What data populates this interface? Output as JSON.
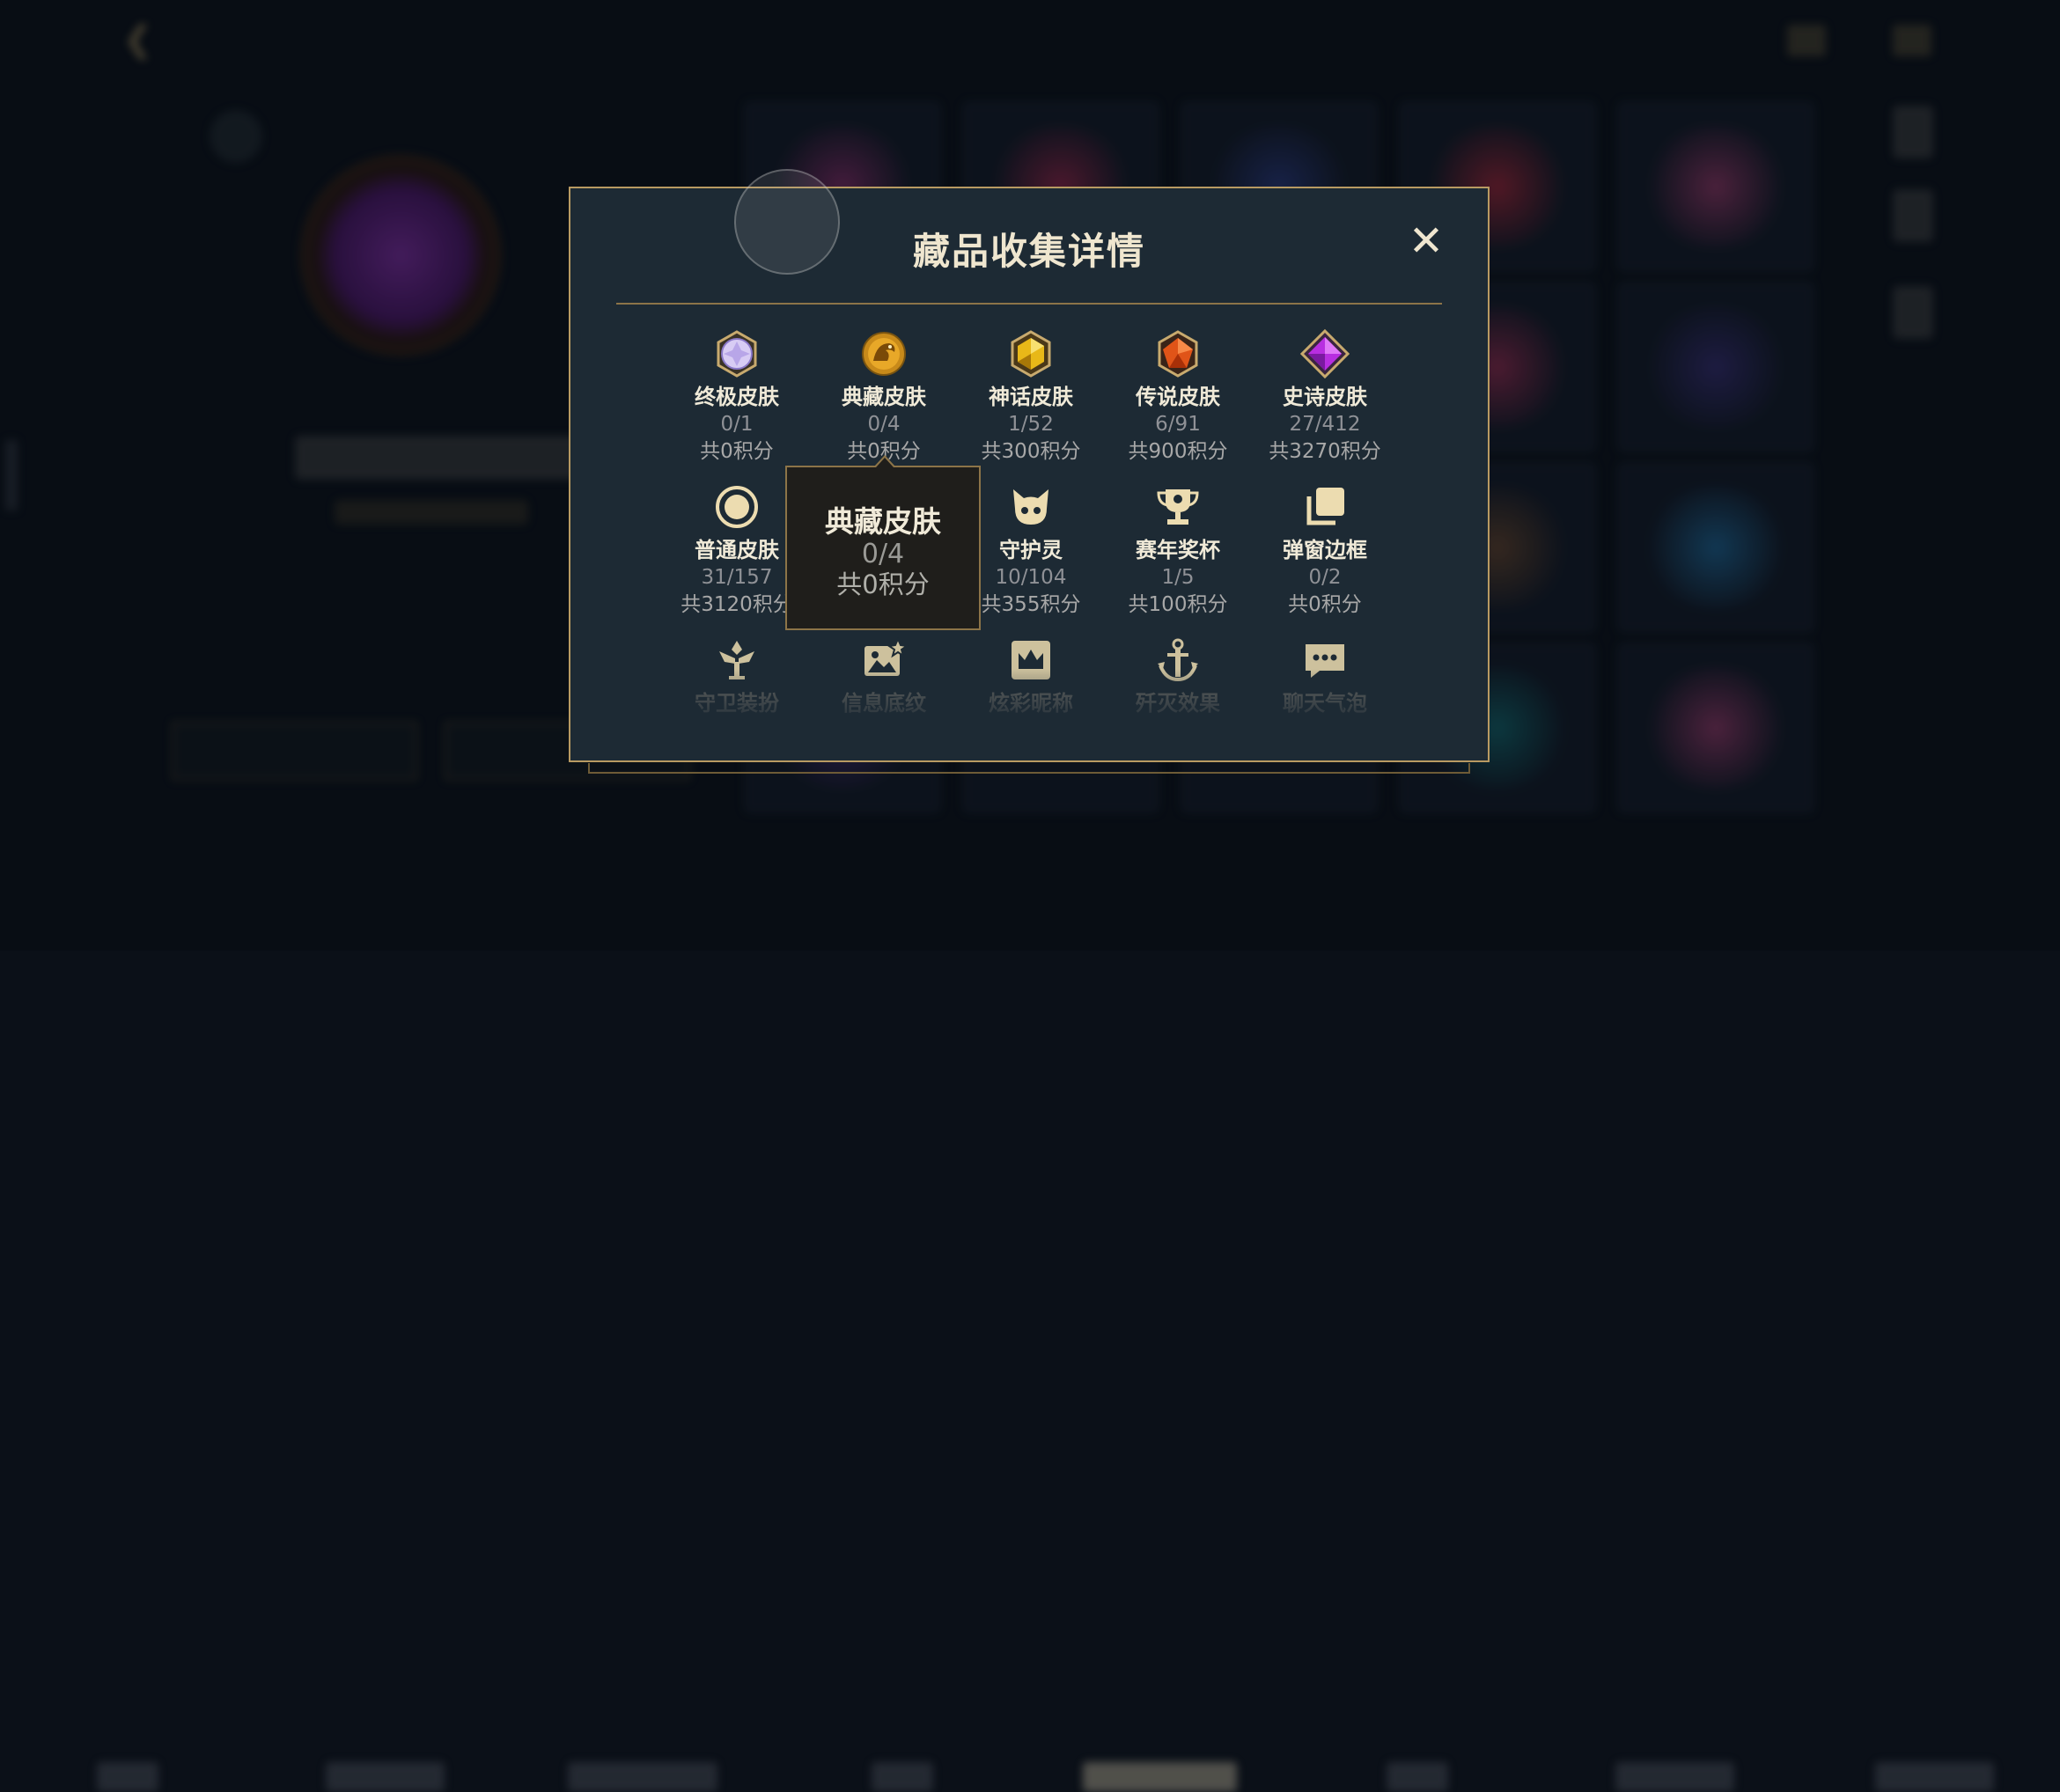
{
  "background": {
    "colors": {
      "page": "#0b1018",
      "accent_gold": "#c8aa6e"
    }
  },
  "modal": {
    "title": "藏品收集详情",
    "close_icon": "close-icon",
    "items": [
      {
        "id": "ultimate",
        "label": "终极皮肤",
        "count": "0/1",
        "points": "共0积分",
        "icon": "ultimate-skin-gem-icon"
      },
      {
        "id": "prestige",
        "label": "典藏皮肤",
        "count": "0/4",
        "points": "共0积分",
        "icon": "prestige-skin-icon"
      },
      {
        "id": "mythic",
        "label": "神话皮肤",
        "count": "1/52",
        "points": "共300积分",
        "icon": "mythic-skin-gem-icon"
      },
      {
        "id": "legendary",
        "label": "传说皮肤",
        "count": "6/91",
        "points": "共900积分",
        "icon": "legendary-skin-gem-icon"
      },
      {
        "id": "epic",
        "label": "史诗皮肤",
        "count": "27/412",
        "points": "共3270积分",
        "icon": "epic-skin-gem-icon"
      },
      {
        "id": "common",
        "label": "普通皮肤",
        "count": "31/157",
        "points": "共3120积分",
        "icon": "common-skin-icon"
      },
      {
        "id": "guardian",
        "label": "守护灵",
        "count": "10/104",
        "points": "共355积分",
        "icon": "guardian-pet-icon"
      },
      {
        "id": "trophy",
        "label": "赛年奖杯",
        "count": "1/5",
        "points": "共100积分",
        "icon": "trophy-icon"
      },
      {
        "id": "frame",
        "label": "弹窗边框",
        "count": "0/2",
        "points": "共0积分",
        "icon": "popup-frame-icon"
      },
      {
        "id": "guardian_outfit",
        "label": "守卫装扮",
        "icon": "ward-skin-icon"
      },
      {
        "id": "info_pattern",
        "label": "信息底纹",
        "icon": "info-pattern-icon"
      },
      {
        "id": "nickname",
        "label": "炫彩昵称",
        "icon": "colorful-nickname-icon"
      },
      {
        "id": "kill_effect",
        "label": "歼灭效果",
        "icon": "kill-effect-icon"
      },
      {
        "id": "chat_bubble",
        "label": "聊天气泡",
        "icon": "chat-bubble-icon"
      }
    ]
  },
  "tooltip": {
    "title": "典藏皮肤",
    "count": "0/4",
    "points": "共0积分"
  },
  "colors": {
    "modal_bg": "#1d2a34",
    "modal_border": "#b89a62",
    "title_text": "#efe6cf",
    "ultimate_gem": "#b8a6e8",
    "mythic_gem": "#e8b818",
    "legendary_gem": "#e05418",
    "epic_gem": "#b82ee0"
  }
}
